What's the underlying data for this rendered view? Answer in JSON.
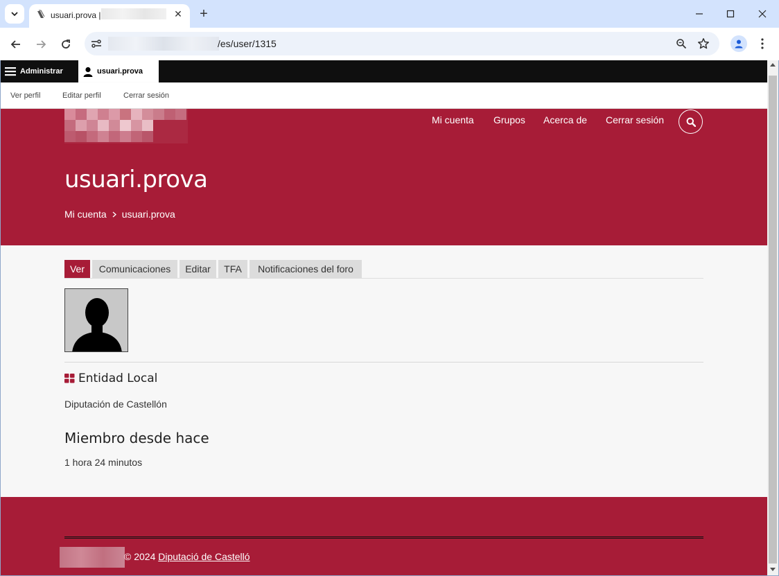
{
  "browser": {
    "tab_title": "usuari.prova |",
    "url_suffix": "/es/user/1315",
    "new_tab": "+",
    "tab_close": "✕"
  },
  "admin": {
    "manage_label": "Administrar",
    "user_label": "usuari.prova",
    "tray": {
      "view_profile": "Ver perfil",
      "edit_profile": "Editar perfil",
      "logout": "Cerrar sesión"
    }
  },
  "nav": {
    "my_account": "Mi cuenta",
    "groups": "Grupos",
    "about": "Acerca de",
    "logout": "Cerrar sesión"
  },
  "page": {
    "title": "usuari.prova",
    "breadcrumb": [
      "Mi cuenta",
      "usuari.prova"
    ],
    "tabs": [
      "Ver",
      "Comunicaciones",
      "Editar",
      "TFA",
      "Notificaciones del foro"
    ],
    "entity_label": "Entidad Local",
    "entity_value": "Diputación de Castellón",
    "member_label": "Miembro desde hace",
    "member_value": "1 hora 24 minutos"
  },
  "footer": {
    "copyright": "© 2024",
    "link": "Diputació de Castelló"
  },
  "colors": {
    "brand": "#a71c37",
    "admin_bar": "#0f0f0f",
    "browser_chrome": "#d3e3fd"
  }
}
